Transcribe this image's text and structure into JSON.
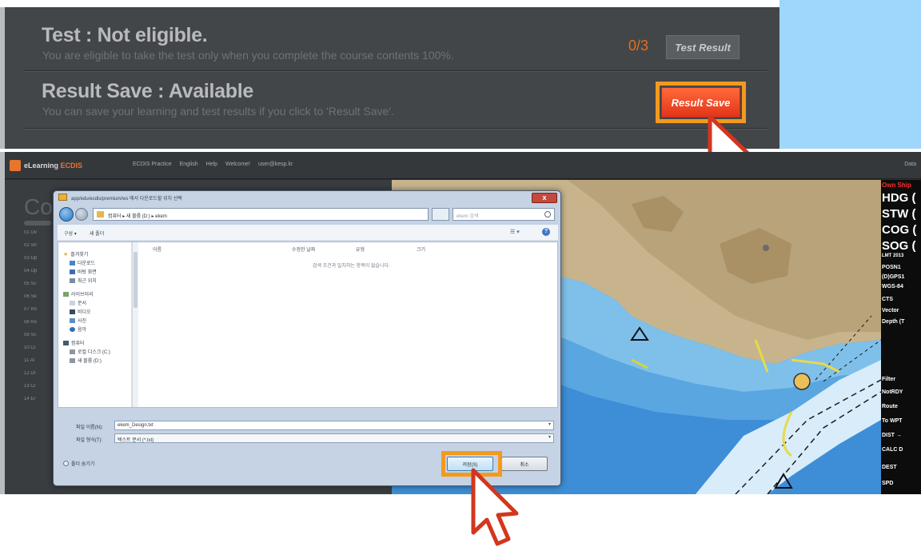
{
  "top_panel": {
    "test_title": "Test : Not eligible.",
    "test_desc": "You are eligible to take the test only when you complete the course contents 100%.",
    "score": "0/3",
    "test_result_button": "Test Result",
    "save_title": "Result Save : Available",
    "save_desc": "You can save your learning and test results if you click to 'Result Save'.",
    "result_save_button": "Result Save",
    "highlight_color": "#f39a1e",
    "accent_red": "#e2351a"
  },
  "app": {
    "logo_prefix": "eLearning",
    "logo_suffix": "ECDIS",
    "menu": [
      "ECDIS Practice",
      "English",
      "Help",
      "Welcome!",
      "user@kesp.kr"
    ],
    "right_label": "Data",
    "side_heading": "Co",
    "side_items": [
      "01 Ov",
      "02 Sh",
      "03 Op",
      "04 Op",
      "05 Sc",
      "06 Se",
      "07 Ro",
      "08 Ro",
      "09 Sc",
      "10 Cl",
      "11 Al",
      "12 Dr",
      "13 Cl",
      "14 Er"
    ]
  },
  "instruments": {
    "header": "Own Ship",
    "hdg": "HDG (",
    "stw": "STW (",
    "cog": "COG (",
    "sog": "SOG (",
    "lmt": "LMT 2013",
    "items": [
      "POSN1",
      "(D)GPS1",
      "WGS-84",
      "CTS",
      "Vector",
      "Depth (T"
    ],
    "items2": [
      "Filter",
      "NotRDY",
      "Route",
      "To WPT",
      "DIST  →",
      "CALC  D",
      "DEST",
      "SPD"
    ]
  },
  "dialog": {
    "title": "app/edu/ecdis/premium/ws 에서 다운로드할 위치 선택",
    "close": "x",
    "address": "컴퓨터 ▸ 새 볼륨 (D:) ▸ ekem",
    "search_placeholder": "ekem 검색",
    "toolbar_organize": "구성 ▾",
    "toolbar_new_folder": "새 폴더",
    "nav_items": [
      {
        "label": "즐겨찾기",
        "icon": "star-icon"
      },
      {
        "label": "다운로드",
        "icon": "download-folder-icon"
      },
      {
        "label": "바탕 화면",
        "icon": "desktop-icon"
      },
      {
        "label": "최근 위치",
        "icon": "recent-places-icon"
      },
      {
        "label": "라이브러리",
        "icon": "library-icon"
      },
      {
        "label": "문서",
        "icon": "documents-icon"
      },
      {
        "label": "비디오",
        "icon": "video-icon"
      },
      {
        "label": "사진",
        "icon": "pictures-icon"
      },
      {
        "label": "음악",
        "icon": "music-icon"
      },
      {
        "label": "컴퓨터",
        "icon": "computer-icon"
      },
      {
        "label": "로컬 디스크 (C:)",
        "icon": "drive-c-icon"
      },
      {
        "label": "새 볼륨 (D:)",
        "icon": "drive-d-icon"
      }
    ],
    "columns": [
      "이름",
      "수정한 날짜",
      "유형",
      "크기"
    ],
    "empty_message": "검색 조건과 일치하는 항목이 없습니다.",
    "filename_label": "파일 이름(N):",
    "filename_value": "ekem_Design.txt",
    "filetype_label": "파일 형식(T):",
    "filetype_value": "텍스트 문서 (*.txt)",
    "hide_folders": "폴더 숨기기",
    "save_button": "저장(S)",
    "cancel_button": "취소"
  }
}
